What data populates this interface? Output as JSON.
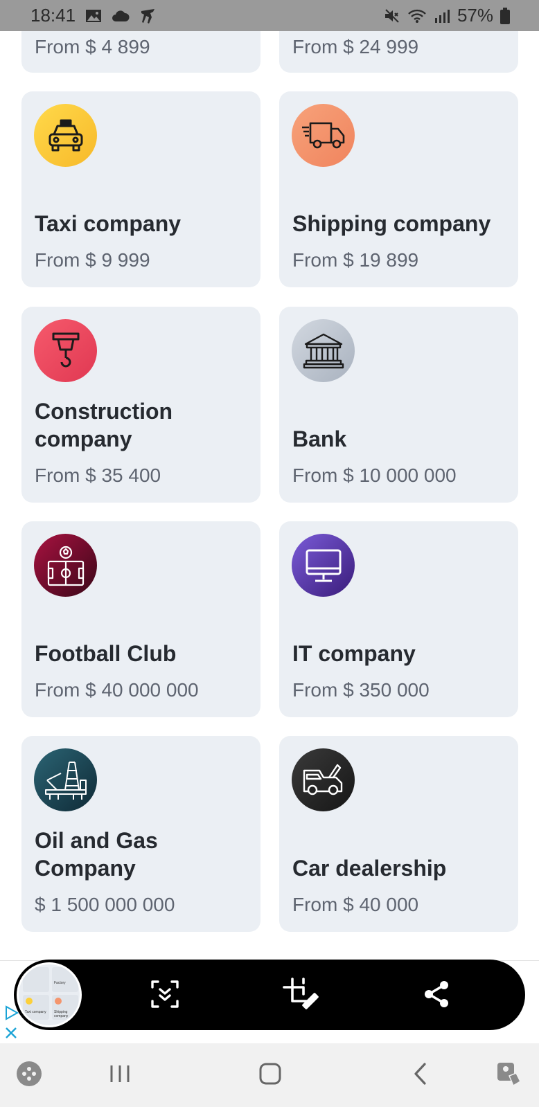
{
  "status": {
    "time": "18:41",
    "battery": "57%"
  },
  "cards": [
    {
      "price": "From $ 4 899"
    },
    {
      "price": "From $ 24 999"
    },
    {
      "title": "Taxi company",
      "price": "From $ 9 999",
      "icon": "taxi-icon",
      "color": "#fcd03a"
    },
    {
      "title": "Shipping company",
      "price": "From $ 19 899",
      "icon": "truck-icon",
      "color": "#f4956d"
    },
    {
      "title": "Construction company",
      "price": "From $ 35 400",
      "icon": "crane-hook-icon",
      "color": "#ef4c62"
    },
    {
      "title": "Bank",
      "price": "From $ 10 000 000",
      "icon": "bank-icon",
      "color": "#c2c9d3"
    },
    {
      "title": "Football Club",
      "price": "From $ 40 000 000",
      "icon": "football-field-icon",
      "color": "#8c0d36"
    },
    {
      "title": "IT company",
      "price": "From $ 350 000",
      "icon": "monitor-icon",
      "color": "#5a3fb0"
    },
    {
      "title": "Oil and Gas Company",
      "price": "$ 1 500 000 000",
      "icon": "oil-rig-icon",
      "color": "#1e4a5a"
    },
    {
      "title": "Car dealership",
      "price": "From $ 40 000",
      "icon": "car-crash-icon",
      "color": "#2b2b2b"
    }
  ],
  "screenshot_toolbar": {
    "thumbnail_labels": [
      "Factory",
      "Taxi company",
      "Shipping company"
    ]
  },
  "navigation": {
    "buttons": [
      "game-launcher-icon",
      "recents-icon",
      "home-icon",
      "back-icon",
      "accessibility-icon"
    ]
  }
}
